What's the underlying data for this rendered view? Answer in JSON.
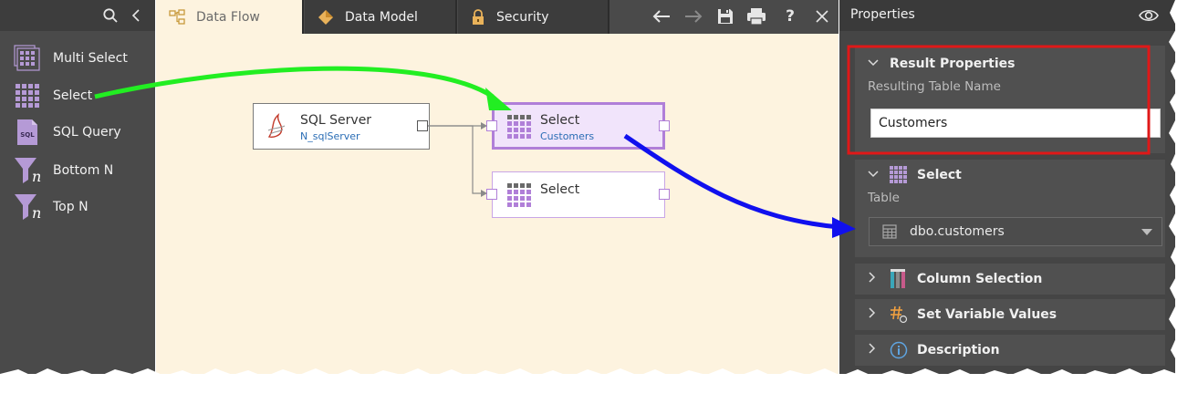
{
  "tools": {
    "items": [
      {
        "label": "Multi Select",
        "icon": "multi-select-icon"
      },
      {
        "label": "Select",
        "icon": "select-grid-icon"
      },
      {
        "label": "SQL Query",
        "icon": "sql-query-icon"
      },
      {
        "label": "Bottom N",
        "icon": "bottom-n-funnel-icon"
      },
      {
        "label": "Top N",
        "icon": "top-n-funnel-icon"
      }
    ],
    "sql_icon_text": "SQL",
    "funnel_letter": "n"
  },
  "tabs": {
    "data_flow": "Data Flow",
    "data_model": "Data Model",
    "security": "Security"
  },
  "toolbar": {
    "help": "?"
  },
  "nodes": {
    "sql_server": {
      "title": "SQL Server",
      "subtitle": "N_sqlServer"
    },
    "select_customers": {
      "title": "Select",
      "subtitle": "Customers"
    },
    "select_empty": {
      "title": "Select"
    }
  },
  "properties": {
    "title": "Properties",
    "result": {
      "header": "Result Properties",
      "label": "Resulting Table Name",
      "value": "Customers"
    },
    "select": {
      "header": "Select",
      "table_label": "Table",
      "table_value": "dbo.customers"
    },
    "collapsed": [
      "Column Selection",
      "Set Variable Values",
      "Description"
    ]
  },
  "colors": {
    "highlight_red": "#e01818",
    "arrow_green": "#22ee22",
    "arrow_blue": "#1010ee",
    "node_purple": "#b07fd8",
    "canvas_bg": "#fdf3df"
  }
}
